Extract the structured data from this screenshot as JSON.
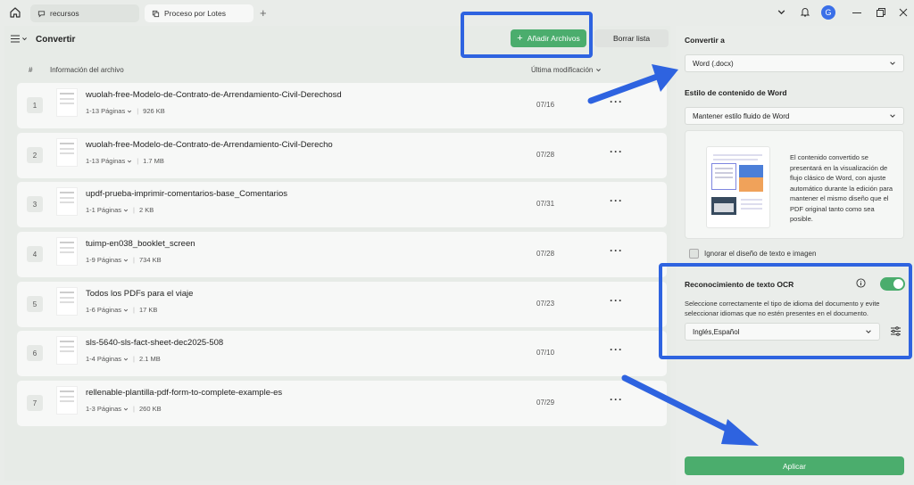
{
  "tabs": [
    {
      "label": "recursos",
      "icon": "chat-icon"
    },
    {
      "label": "Proceso por Lotes",
      "icon": "copy-icon"
    }
  ],
  "window_controls": {
    "avatar_letter": "G"
  },
  "header": {
    "title": "Convertir",
    "add_button": "Añadir Archivos",
    "clear_button": "Borrar lista"
  },
  "table": {
    "col_num": "#",
    "col_info": "Información del archivo",
    "col_date": "Última modificación"
  },
  "files": [
    {
      "num": "1",
      "name": "wuolah-free-Modelo-de-Contrato-de-Arrendamiento-Civil-Derechosd",
      "pages": "1-13 Páginas",
      "size": "926 KB",
      "date": "07/16"
    },
    {
      "num": "2",
      "name": "wuolah-free-Modelo-de-Contrato-de-Arrendamiento-Civil-Derecho",
      "pages": "1-13 Páginas",
      "size": "1.7 MB",
      "date": "07/28"
    },
    {
      "num": "3",
      "name": "updf-prueba-imprimir-comentarios-base_Comentarios",
      "pages": "1-1 Páginas",
      "size": "2 KB",
      "date": "07/31"
    },
    {
      "num": "4",
      "name": "tuimp-en038_booklet_screen",
      "pages": "1-9 Páginas",
      "size": "734 KB",
      "date": "07/28"
    },
    {
      "num": "5",
      "name": "Todos los PDFs para el viaje",
      "pages": "1-6 Páginas",
      "size": "17 KB",
      "date": "07/23"
    },
    {
      "num": "6",
      "name": "sls-5640-sls-fact-sheet-dec2025-508",
      "pages": "1-4 Páginas",
      "size": "2.1 MB",
      "date": "07/10"
    },
    {
      "num": "7",
      "name": "rellenable-plantilla-pdf-form-to-complete-example-es",
      "pages": "1-3 Páginas",
      "size": "260 KB",
      "date": "07/29"
    }
  ],
  "right": {
    "convert_to_label": "Convertir a",
    "convert_to_value": "Word (.docx)",
    "style_label": "Estilo de contenido de Word",
    "style_value": "Mantener estilo fluido de Word",
    "style_description": "El contenido convertido se presentará en la visualización de flujo clásico de Word, con ajuste automático durante la edición para mantener el mismo diseño que el PDF original tanto como sea posible.",
    "ignore_label": "Ignorar el diseño de texto e imagen",
    "ocr_label": "Reconocimiento de texto OCR",
    "ocr_description": "Seleccione correctamente el tipo de idioma del documento y evite seleccionar idiomas que no estén presentes en el documento.",
    "ocr_language": "Inglés,Español",
    "apply_button": "Aplicar"
  },
  "colors": {
    "accent": "#4bad6d",
    "highlight": "#2e63e0"
  }
}
